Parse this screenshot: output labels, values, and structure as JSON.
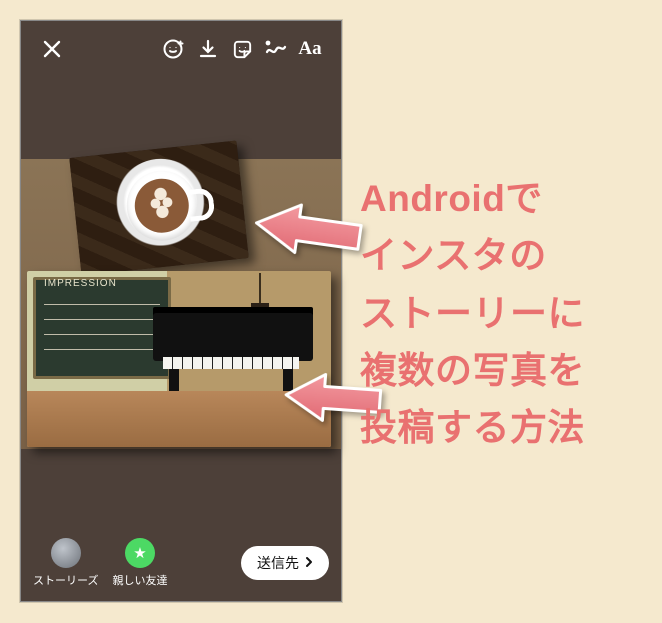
{
  "toolbar": {
    "close": "close-icon",
    "face": "face-sticker-icon",
    "download": "download-icon",
    "sticker": "sticker-icon",
    "draw": "draw-icon",
    "text_label": "Aa"
  },
  "bottom": {
    "stories_label": "ストーリーズ",
    "close_friends_label": "親しい友達",
    "send_label": "送信先"
  },
  "headline": {
    "line1": "Androidで",
    "line2": "インスタの",
    "line3": "ストーリーに",
    "line4": "複数の写真を",
    "line5": "投稿する方法"
  },
  "board_text": "IMPRESSION"
}
